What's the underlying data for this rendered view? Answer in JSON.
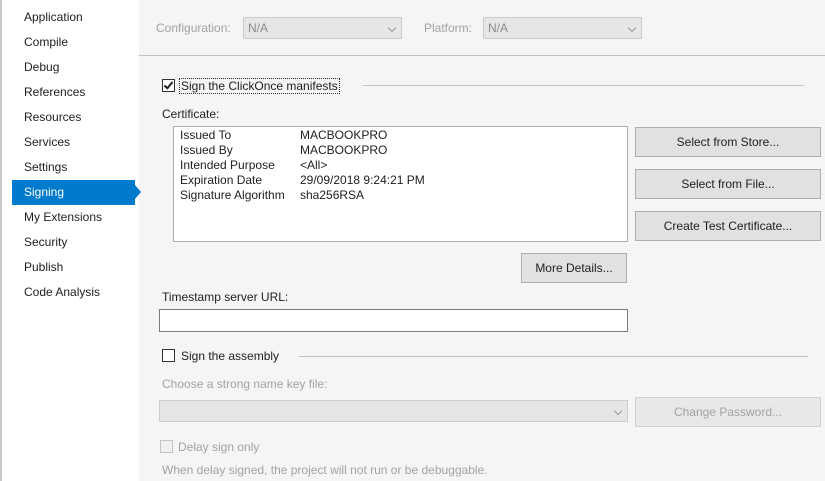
{
  "sidebar": {
    "items": [
      {
        "label": "Application"
      },
      {
        "label": "Compile"
      },
      {
        "label": "Debug"
      },
      {
        "label": "References"
      },
      {
        "label": "Resources"
      },
      {
        "label": "Services"
      },
      {
        "label": "Settings"
      },
      {
        "label": "Signing",
        "active": true
      },
      {
        "label": "My Extensions"
      },
      {
        "label": "Security"
      },
      {
        "label": "Publish"
      },
      {
        "label": "Code Analysis"
      }
    ]
  },
  "toolbar": {
    "configuration_label": "Configuration:",
    "configuration_value": "N/A",
    "platform_label": "Platform:",
    "platform_value": "N/A"
  },
  "signing": {
    "sign_manifests_label": "Sign the ClickOnce manifests",
    "sign_manifests_checked": true,
    "certificate_label": "Certificate:",
    "certificate": {
      "issued_to_key": "Issued To",
      "issued_to_val": "MACBOOKPRO",
      "issued_by_key": "Issued By",
      "issued_by_val": "MACBOOKPRO",
      "purpose_key": "Intended Purpose",
      "purpose_val": "<All>",
      "expiration_key": "Expiration Date",
      "expiration_val": "29/09/2018 9:24:21 PM",
      "algorithm_key": "Signature Algorithm",
      "algorithm_val": "sha256RSA"
    },
    "select_store_label": "Select from Store...",
    "select_file_label": "Select from File...",
    "create_test_label": "Create Test Certificate...",
    "more_details_label": "More Details...",
    "timestamp_label": "Timestamp server URL:",
    "timestamp_value": ""
  },
  "assembly": {
    "sign_assembly_label": "Sign the assembly",
    "sign_assembly_checked": false,
    "key_file_label": "Choose a strong name key file:",
    "key_file_value": "",
    "change_password_label": "Change Password...",
    "delay_sign_label": "Delay sign only",
    "delay_sign_note": "When delay signed, the project will not run or be debuggable."
  },
  "colors": {
    "accent": "#007acc",
    "background": "#f5f5f5",
    "sidebar_bg": "#ffffff"
  }
}
